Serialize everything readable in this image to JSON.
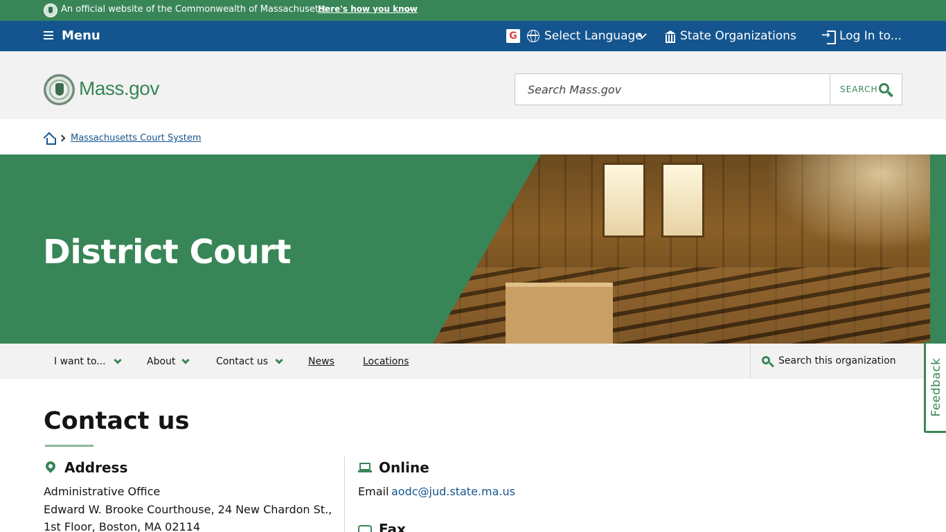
{
  "official_banner": {
    "text": "An official website of the Commonwealth of Massachusetts",
    "how_link": "Here's how you know"
  },
  "utility_nav": {
    "menu": "Menu",
    "google_glyph": "G",
    "select_language": "Select Language",
    "state_organizations": "State Organizations",
    "log_in": "Log In to..."
  },
  "header": {
    "logo_text": "Mass.gov",
    "search_placeholder": "Search Mass.gov",
    "search_button": "SEARCH"
  },
  "breadcrumb": {
    "items": [
      "Massachusetts Court System"
    ]
  },
  "hero": {
    "title": "District Court"
  },
  "org_nav": {
    "items": [
      {
        "label": "I want to...",
        "dropdown": true
      },
      {
        "label": "About",
        "dropdown": true
      },
      {
        "label": "Contact us",
        "dropdown": true
      },
      {
        "label": "News",
        "dropdown": false
      },
      {
        "label": "Locations",
        "dropdown": false
      }
    ],
    "search_org": "Search this organization"
  },
  "feedback": "Feedback",
  "contact": {
    "title": "Contact us",
    "address": {
      "heading": "Address",
      "lines": [
        "Administrative Office",
        "Edward W. Brooke Courthouse, 24 New Chardon St.,",
        "1st Floor, Boston, MA 02114"
      ]
    },
    "online": {
      "heading": "Online",
      "email_label": "Email",
      "email": "aodc@jud.state.ma.us"
    },
    "fax": {
      "heading": "Fax"
    }
  },
  "colors": {
    "green": "#388557",
    "blue": "#14558f",
    "gray_bg": "#f2f2f2"
  },
  "icons": [
    "seal-icon",
    "hamburger-icon",
    "google-translate-icon",
    "globe-icon",
    "chevron-down-icon",
    "building-icon",
    "login-icon",
    "search-icon",
    "home-icon",
    "chevron-right-icon",
    "map-pin-icon",
    "laptop-icon",
    "fax-icon"
  ]
}
